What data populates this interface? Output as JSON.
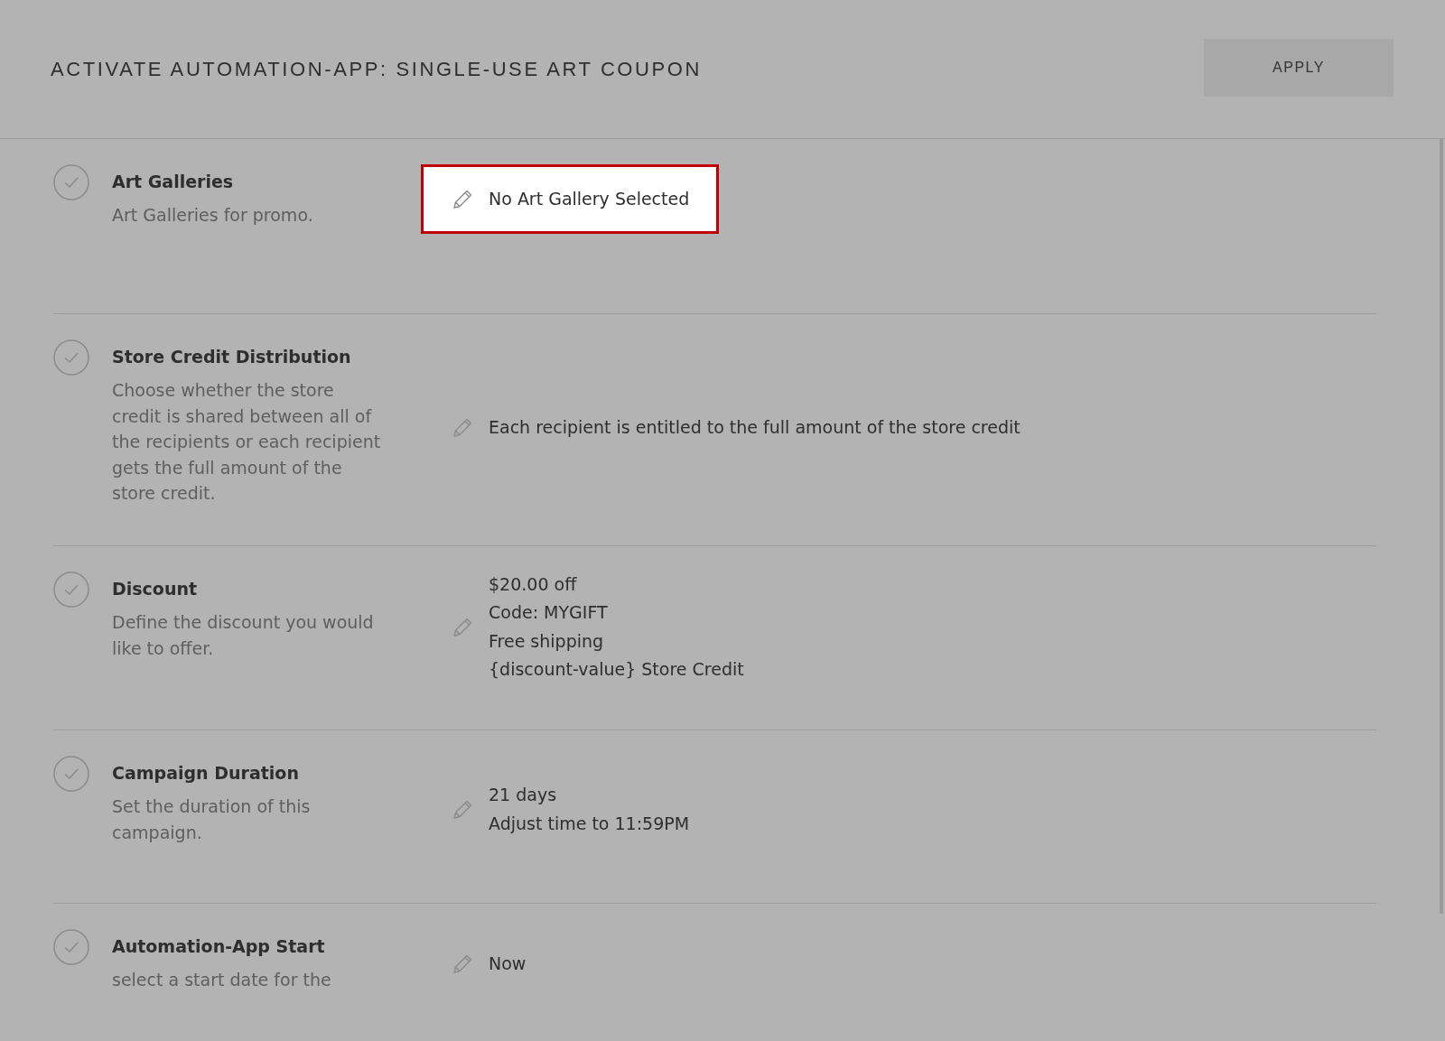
{
  "header": {
    "title": "ACTIVATE AUTOMATION-APP: SINGLE-USE ART COUPON",
    "button": "APPLY"
  },
  "steps": [
    {
      "title": "Art Galleries",
      "description": "Art Galleries for promo.",
      "value_lines": [
        "No Art Gallery Selected"
      ],
      "highlighted": true
    },
    {
      "title": "Store Credit Distribution",
      "description": "Choose whether the store credit is shared between all of the recipients or each recipient gets the full amount of the store credit.",
      "value_lines": [
        "Each recipient is entitled to the full amount of the store credit"
      ],
      "highlighted": false
    },
    {
      "title": "Discount",
      "description": "Define the discount you would like to offer.",
      "value_lines": [
        "$20.00 off",
        "Code: MYGIFT",
        "Free shipping",
        "{discount-value} Store Credit"
      ],
      "highlighted": false
    },
    {
      "title": "Campaign Duration",
      "description": "Set the duration of this campaign.",
      "value_lines": [
        "21 days",
        "Adjust time to 11:59PM"
      ],
      "highlighted": false
    },
    {
      "title": "Automation-App Start",
      "description": "select a start date for the",
      "value_lines": [
        "Now"
      ],
      "highlighted": false
    }
  ]
}
